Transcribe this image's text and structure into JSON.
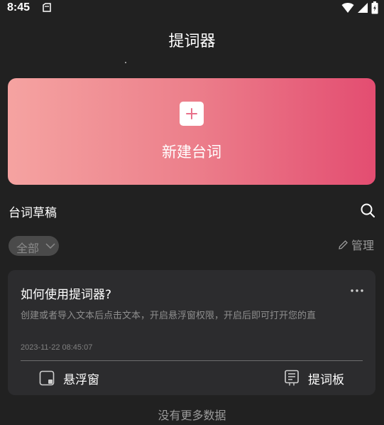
{
  "status_bar": {
    "time": "8:45"
  },
  "header": {
    "title": "提词器"
  },
  "new_script": {
    "label": "新建台词",
    "gradient": [
      "#f5a3a1",
      "#e34d71"
    ]
  },
  "section": {
    "title": "台词草稿"
  },
  "filter": {
    "selected": "全部"
  },
  "manage": {
    "label": "管理"
  },
  "scripts": [
    {
      "title": "如何使用提词器?",
      "preview": "创建或者导入文本后点击文本，开启悬浮窗权限，开启后即可打开您的直",
      "date": "2023-11-22 08:45:07",
      "actions": {
        "float_label": "悬浮窗",
        "board_label": "提词板"
      }
    }
  ],
  "footer": {
    "no_more_text": "没有更多数据"
  },
  "icons": {
    "notification": "notification-icon",
    "wifi": "wifi-icon",
    "signal": "signal-icon",
    "battery": "battery-icon",
    "plus": "plus-icon",
    "search": "search-icon",
    "chevron": "chevron-down-icon",
    "edit": "pencil-icon",
    "more": "more-horizontal-icon",
    "float": "floating-window-icon",
    "board": "teleprompter-board-icon"
  }
}
